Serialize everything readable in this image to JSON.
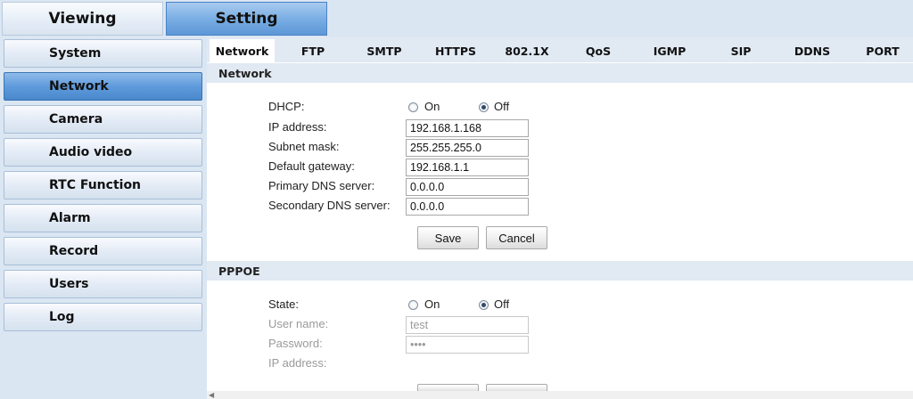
{
  "top_tabs": {
    "viewing": "Viewing",
    "setting": "Setting"
  },
  "sidebar": {
    "items": [
      {
        "label": "System"
      },
      {
        "label": "Network"
      },
      {
        "label": "Camera"
      },
      {
        "label": "Audio video"
      },
      {
        "label": "RTC Function"
      },
      {
        "label": "Alarm"
      },
      {
        "label": "Record"
      },
      {
        "label": "Users"
      },
      {
        "label": "Log"
      }
    ],
    "active": "Network"
  },
  "subtabs": [
    "Network",
    "FTP",
    "SMTP",
    "HTTPS",
    "802.1X",
    "QoS",
    "IGMP",
    "SIP",
    "DDNS",
    "PORT"
  ],
  "network": {
    "title": "Network",
    "dhcp_label": "DHCP:",
    "dhcp_on": "On",
    "dhcp_off": "Off",
    "dhcp_value": "Off",
    "ip_label": "IP address:",
    "ip_value": "192.168.1.168",
    "subnet_label": "Subnet mask:",
    "subnet_value": "255.255.255.0",
    "gateway_label": "Default gateway:",
    "gateway_value": "192.168.1.1",
    "dns1_label": "Primary DNS server:",
    "dns1_value": "0.0.0.0",
    "dns2_label": "Secondary DNS server:",
    "dns2_value": "0.0.0.0",
    "save": "Save",
    "cancel": "Cancel"
  },
  "pppoe": {
    "title": "PPPOE",
    "state_label": "State:",
    "state_on": "On",
    "state_off": "Off",
    "state_value": "Off",
    "user_label": "User name:",
    "user_value": "test",
    "password_label": "Password:",
    "password_value": "test",
    "ip_label": "IP address:"
  },
  "colors": {
    "active_tab": "#6fa5e0",
    "page_bg": "#dbe6f3",
    "section_header": "#e1e9f3"
  }
}
